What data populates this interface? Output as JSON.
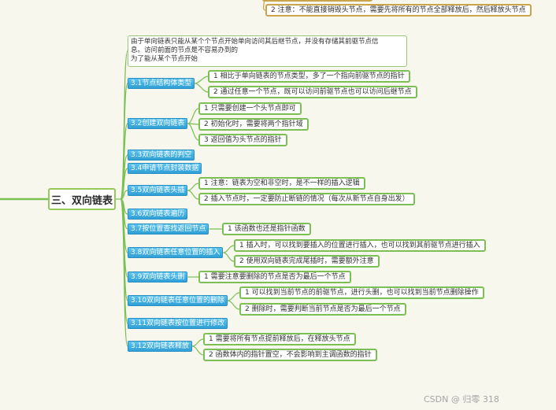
{
  "mindmap": {
    "root": "三、双向链表",
    "top_note": "2 注意：不能直接销毁头节点，需要先将所有的节点全部释放后，然后释放头节点",
    "intro_lines": [
      "由于单向链表只能从某个个节点开始单向访问其后继节点，并没有存储其前驱节点信",
      "息。访问前面的节点是不容易办到的",
      "为了能从某个节点开始"
    ],
    "sections": [
      {
        "label": "3.1节点结构体类型",
        "children": [
          "1 相比于单向链表的节点类型，多了一个指向前驱节点的指针",
          "2 通过任意一个节点，既可以访问前驱节点也可以访问后继节点"
        ]
      },
      {
        "label": "3.2创建双向链表",
        "children": [
          "1 只需要创建一个头节点即可",
          "2 初始化时，需要将两个指针域",
          "3 返回值为头节点的指针"
        ]
      },
      {
        "label": "3.3双向链表的判空",
        "children": []
      },
      {
        "label": "3.4申请节点封装数据",
        "children": []
      },
      {
        "label": "3.5双向链表头插",
        "children": [
          "1 注意：链表为空和非空时，是不一样的插入逻辑",
          "2 插入节点时，一定要防止断链的情况（每次从新节点自身出发）"
        ]
      },
      {
        "label": "3.6双向链表遍历",
        "children": []
      },
      {
        "label": "3.7按位置查找返回节点",
        "children": [
          "1 该函数也还是指针函数"
        ]
      },
      {
        "label": "3.8双向链表任意位置的插入",
        "children": [
          "1 插入时，可以找到要插入的位置进行插入，也可以找到其前驱节点进行插入",
          "2 使用双向链表完成尾插时，需要额外注意"
        ]
      },
      {
        "label": "3.9双向链表头删",
        "children": [
          "1 需要注意要删除的节点是否为最后一个节点"
        ]
      },
      {
        "label": "3.10双向链表任意位置的删除",
        "children": [
          "1 可以找到当前节点的前驱节点，进行头删，也可以找到当前节点删除操作",
          "2 删除时，需要判断当前节点是否为最后一个节点"
        ]
      },
      {
        "label": "3.11双向链表按位置进行修改",
        "children": []
      },
      {
        "label": "3.12双向链表释放",
        "children": [
          "1 需要将所有节点提前释放后，在释放头节点",
          "2 函数体内的指针置空，不会影响到主调函数的指针"
        ]
      }
    ],
    "watermark": "CSDN @ 归零 318",
    "colors": {
      "branch": "#7cbf55",
      "section": "#2f9fd6",
      "accent": "#c9a44a"
    }
  }
}
